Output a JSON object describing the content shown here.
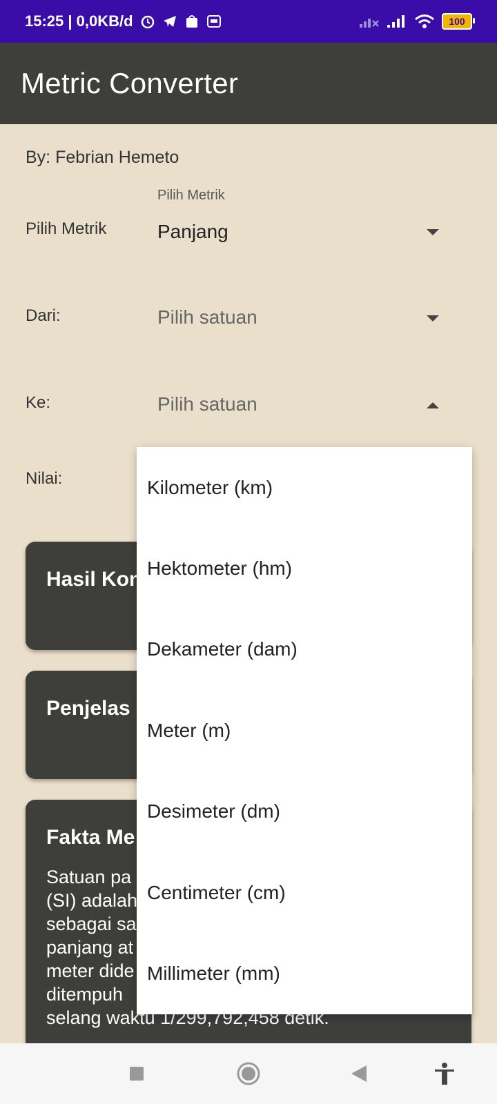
{
  "status_bar": {
    "time_text": "15:25 | 0,0KB/d",
    "battery": "100",
    "colors": {
      "bg": "#3A0CA8"
    }
  },
  "app_bar": {
    "title": "Metric Converter",
    "colors": {
      "bg": "#3E3E3B"
    }
  },
  "author": "By: Febrian Hemeto",
  "fields": {
    "metric": {
      "label": "Pilih Metrik",
      "floating_label": "Pilih Metrik",
      "value": "Panjang"
    },
    "from": {
      "label": "Dari:",
      "placeholder": "Pilih satuan"
    },
    "to": {
      "label": "Ke:",
      "placeholder": "Pilih satuan"
    },
    "value": {
      "label": "Nilai:"
    }
  },
  "cards": {
    "result": {
      "title": "Hasil Kon"
    },
    "explanation": {
      "title": "Penjelas"
    },
    "fact": {
      "title": "Fakta Me",
      "text": "Satuan pa\n(SI) adalah\nsebagai sa\npanjang at\nmeter dide\nditempuh\nselang waktu 1/299,792,458 detik."
    }
  },
  "dropdown_menu": {
    "items": [
      "Kilometer (km)",
      "Hektometer (hm)",
      "Dekameter (dam)",
      "Meter (m)",
      "Desimeter (dm)",
      "Centimeter (cm)",
      "Millimeter (mm)"
    ]
  },
  "nav_bar": {
    "icons": [
      "recents-icon",
      "home-icon",
      "back-icon",
      "accessibility-icon"
    ]
  },
  "colors": {
    "background": "#EADFCB",
    "card": "#3E3E3B",
    "menu": "#FFFFFF"
  }
}
